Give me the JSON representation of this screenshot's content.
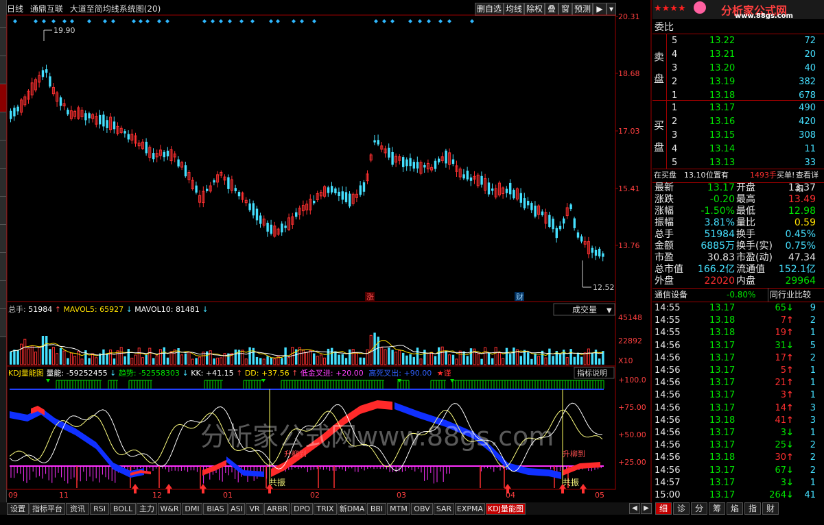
{
  "header": {
    "period": "日线",
    "stock_name": "通鼎互联",
    "indicator_name": "大道至简均线系统图(20)",
    "buttons": [
      "删自选",
      "均线",
      "除权",
      "叠",
      "窗",
      "预测",
      "▶"
    ]
  },
  "price_axis": [
    "20.31",
    "18.68",
    "17.03",
    "15.41",
    "13.76"
  ],
  "price_marks": {
    "high": "19.90",
    "low": "12.52",
    "tag_zhang": "涨",
    "tag_cai": "财"
  },
  "volume_panel": {
    "label_total": "总手:",
    "total": "51984",
    "mavol5_label": "MAVOL5:",
    "mavol5": "65927",
    "mavol10_label": "MAVOL10:",
    "mavol10": "81481",
    "selector": "成交量",
    "axis": [
      "45148",
      "22892"
    ],
    "unit": "X10"
  },
  "kdj_panel": {
    "name": "KDJ量能图",
    "liangneng_label": "量能:",
    "liangneng": "-59252455",
    "qushi_label": "趋势:",
    "qushi": "-52558303",
    "kk": "KK: +41.15",
    "dd": "DD: +37.56",
    "dijin": "低金叉进: +20.00",
    "gaosi": "高死叉出: +90.00",
    "jin": "★谨",
    "explain_button": "指标说明",
    "axis": [
      "+100.0",
      "+75.00",
      "+50.00",
      "+25.00"
    ],
    "annotations": [
      "共振",
      "共振",
      "升柳到",
      "升柳到"
    ]
  },
  "watermark": "分析家公式网www.88gs.com",
  "x_axis": [
    "09",
    "11",
    "12",
    "01",
    "02",
    "03",
    "04",
    "05"
  ],
  "logo": {
    "text": "分析家公式网",
    "url": "www.88gs.com",
    "stars": "★★★★"
  },
  "order_book": {
    "title": "委比",
    "sell_label": [
      "卖",
      "盘"
    ],
    "buy_label": [
      "买",
      "盘"
    ],
    "sell": [
      {
        "level": "5",
        "price": "13.22",
        "vol": "72"
      },
      {
        "level": "4",
        "price": "13.21",
        "vol": "20"
      },
      {
        "level": "3",
        "price": "13.20",
        "vol": "40"
      },
      {
        "level": "2",
        "price": "13.19",
        "vol": "382"
      },
      {
        "level": "1",
        "price": "13.18",
        "vol": "678"
      }
    ],
    "buy": [
      {
        "level": "1",
        "price": "13.17",
        "vol": "490"
      },
      {
        "level": "2",
        "price": "13.16",
        "vol": "420"
      },
      {
        "level": "3",
        "price": "13.15",
        "vol": "308"
      },
      {
        "level": "4",
        "price": "13.14",
        "vol": "11"
      },
      {
        "level": "5",
        "price": "13.13",
        "vol": "33"
      }
    ],
    "note_prefix": "在买盘",
    "note_price": "13.10",
    "note_mid": "位置有",
    "note_vol": "1493手",
    "note_buy": "买单!",
    "note_link": "查看详细"
  },
  "quote": [
    {
      "l": "最新",
      "lv": "13.17",
      "lc": "green",
      "r": "开盘",
      "rv": "13.37",
      "rc": "white"
    },
    {
      "l": "涨跌",
      "lv": "-0.20",
      "lc": "green",
      "r": "最高",
      "rv": "13.49",
      "rc": "red"
    },
    {
      "l": "涨幅",
      "lv": "-1.50%",
      "lc": "green",
      "r": "最低",
      "rv": "12.98",
      "rc": "green"
    },
    {
      "l": "振幅",
      "lv": "3.81%",
      "lc": "cyan",
      "r": "量比",
      "rv": "0.59",
      "rc": "yellow"
    },
    {
      "l": "总手",
      "lv": "51984",
      "lc": "cyan",
      "r": "换手",
      "rv": "0.45%",
      "rc": "cyan"
    },
    {
      "l": "金额",
      "lv": "6885万",
      "lc": "cyan",
      "r": "换手(实)",
      "rv": "0.75%",
      "rc": "cyan"
    },
    {
      "l": "市盈",
      "lv": "30.83",
      "lc": "white",
      "r": "市盈(动)",
      "rv": "47.34",
      "rc": "white"
    },
    {
      "l": "总市值",
      "lv": "166.2亿",
      "lc": "cyan",
      "r": "流通值",
      "rv": "152.1亿",
      "rc": "cyan"
    },
    {
      "l": "外盘",
      "lv": "22020",
      "lc": "red",
      "r": "内盘",
      "rv": "29964",
      "rc": "green"
    }
  ],
  "industry": {
    "name": "通信设备",
    "change": "-0.80%",
    "compare": "同行业比较"
  },
  "ticks": [
    {
      "t": "14:55",
      "p": "13.17",
      "pc": "green",
      "v": "65",
      "d": "down",
      "n": "9"
    },
    {
      "t": "14:55",
      "p": "13.18",
      "pc": "green",
      "v": "7",
      "d": "up",
      "n": "2"
    },
    {
      "t": "14:55",
      "p": "13.18",
      "pc": "green",
      "v": "19",
      "d": "up",
      "n": "1"
    },
    {
      "t": "14:56",
      "p": "13.17",
      "pc": "green",
      "v": "31",
      "d": "down",
      "n": "5"
    },
    {
      "t": "14:56",
      "p": "13.17",
      "pc": "green",
      "v": "17",
      "d": "up",
      "n": "2"
    },
    {
      "t": "14:56",
      "p": "13.17",
      "pc": "green",
      "v": "5",
      "d": "up",
      "n": "1"
    },
    {
      "t": "14:56",
      "p": "13.17",
      "pc": "green",
      "v": "21",
      "d": "up",
      "n": "1"
    },
    {
      "t": "14:56",
      "p": "13.17",
      "pc": "green",
      "v": "3",
      "d": "up",
      "n": "1"
    },
    {
      "t": "14:56",
      "p": "13.17",
      "pc": "green",
      "v": "14",
      "d": "up",
      "n": "3"
    },
    {
      "t": "14:56",
      "p": "13.18",
      "pc": "green",
      "v": "41",
      "d": "up",
      "n": "3"
    },
    {
      "t": "14:56",
      "p": "13.17",
      "pc": "green",
      "v": "3",
      "d": "down",
      "n": "1"
    },
    {
      "t": "14:56",
      "p": "13.17",
      "pc": "green",
      "v": "25",
      "d": "down",
      "n": "2"
    },
    {
      "t": "14:56",
      "p": "13.18",
      "pc": "green",
      "v": "30",
      "d": "up",
      "n": "2"
    },
    {
      "t": "14:56",
      "p": "13.17",
      "pc": "green",
      "v": "67",
      "d": "down",
      "n": "2"
    },
    {
      "t": "14:57",
      "p": "13.17",
      "pc": "green",
      "v": "3",
      "d": "down",
      "n": "1"
    },
    {
      "t": "15:00",
      "p": "13.17",
      "pc": "green",
      "v": "264",
      "d": "down",
      "n": "41"
    }
  ],
  "bottom_tabs": [
    "设置",
    "指标平台",
    "资讯",
    "RSI",
    "BOLL",
    "主力",
    "W&R",
    "DMI",
    "BIAS",
    "ASI",
    "VR",
    "ARBR",
    "DPO",
    "TRIX",
    "新DMA",
    "BBI",
    "MTM",
    "OBV",
    "SAR",
    "EXPMA",
    "KDJ量能图"
  ],
  "right_tabs": [
    "细",
    "诊",
    "分",
    "筹",
    "焰",
    "指",
    "财"
  ],
  "colors": {
    "up": "#ff3030",
    "down": "#45e0ff",
    "axis": "#8b0000",
    "frame": "#a00000"
  }
}
